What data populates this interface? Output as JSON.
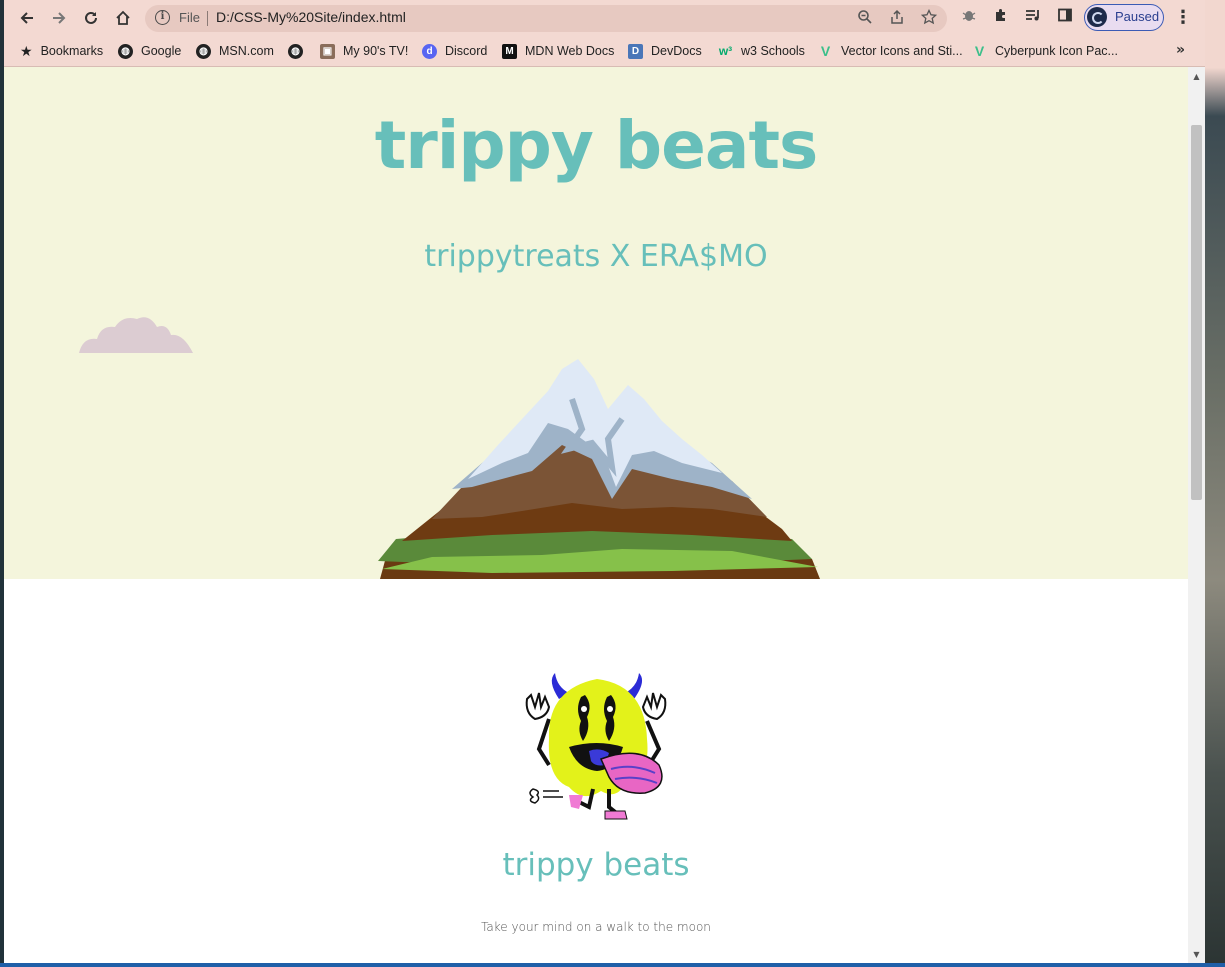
{
  "browser": {
    "url_scheme": "File",
    "url": "D:/CSS-My%20Site/index.html",
    "profile_label": "Paused"
  },
  "bookmarks": [
    {
      "label": "Bookmarks",
      "icon": "star-icon"
    },
    {
      "label": "Google",
      "icon": "globe-icon"
    },
    {
      "label": "MSN.com",
      "icon": "globe-icon"
    },
    {
      "label": "",
      "icon": "globe-icon"
    },
    {
      "label": "My 90's TV!",
      "icon": "tv-icon"
    },
    {
      "label": "Discord",
      "icon": "discord-icon"
    },
    {
      "label": "MDN Web Docs",
      "icon": "mdn-icon"
    },
    {
      "label": "DevDocs",
      "icon": "devdocs-icon"
    },
    {
      "label": "w3 Schools",
      "icon": "w3schools-icon"
    },
    {
      "label": "Vector Icons and Sti...",
      "icon": "vector-icon"
    },
    {
      "label": "Cyberpunk Icon Pac...",
      "icon": "vector-icon"
    }
  ],
  "page": {
    "hero_title": "trippy beats",
    "hero_subtitle": "trippytreats X ERA$MO",
    "section_title": "trippy beats",
    "section_text": "Take your mind on a walk to the moon"
  },
  "colors": {
    "accent": "#67bfba",
    "hero_bg": "#f4f5dc",
    "browser_chrome": "#f3d9d2"
  }
}
